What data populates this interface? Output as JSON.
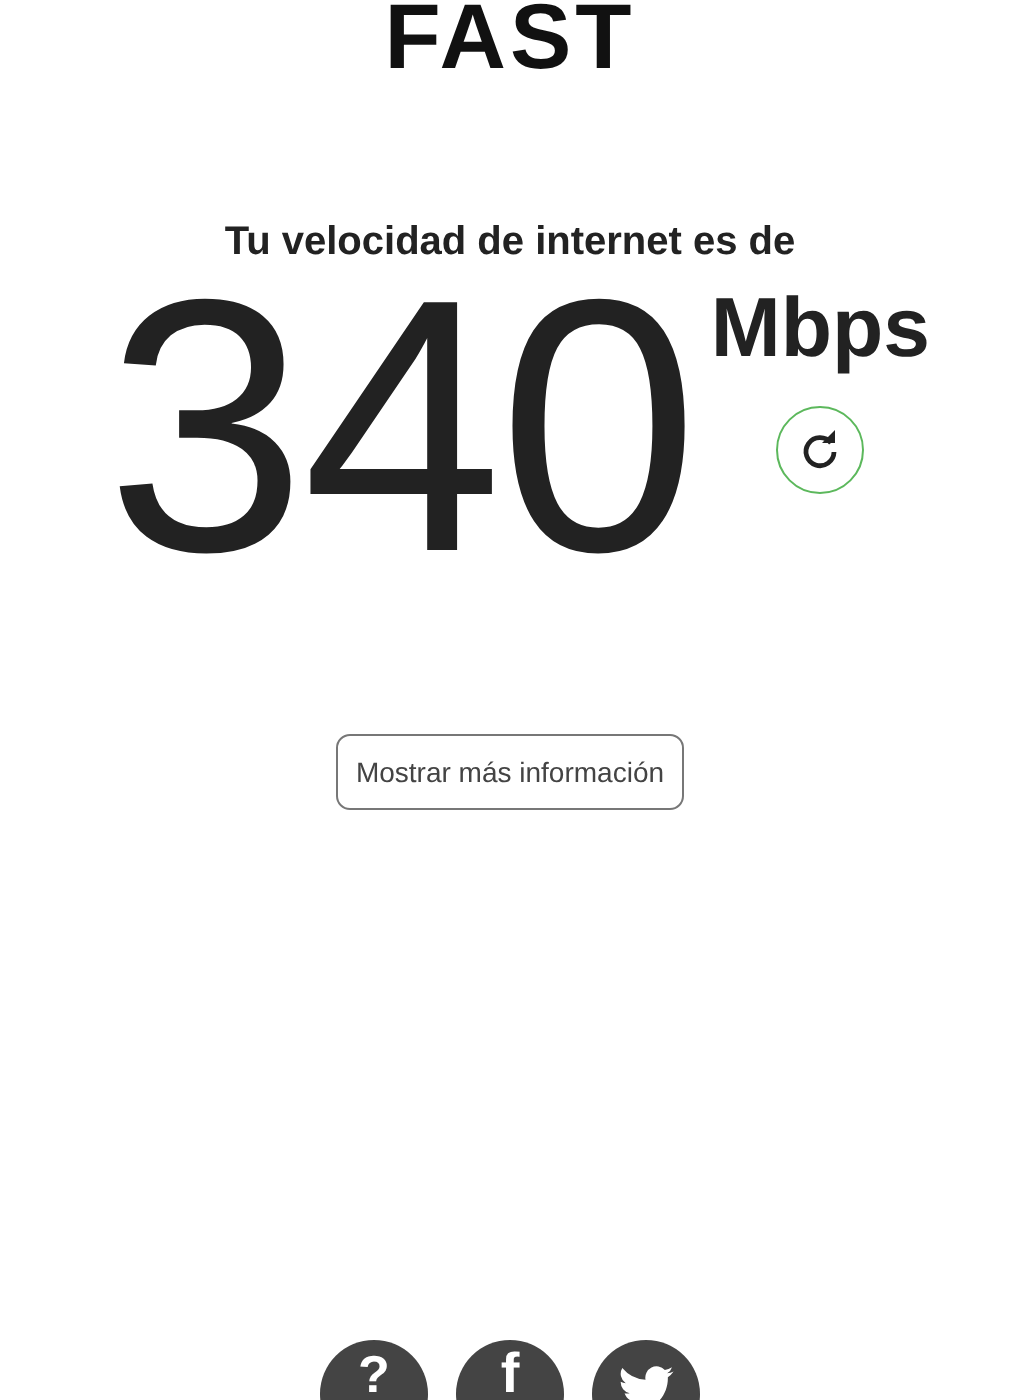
{
  "logo": "FAST",
  "heading": "Tu velocidad de internet es de",
  "speed": {
    "value": "340",
    "unit": "Mbps"
  },
  "more_button": "Mostrar más información",
  "footer_icons": [
    {
      "kind": "help",
      "glyph": "?"
    },
    {
      "kind": "facebook",
      "glyph": "f"
    },
    {
      "kind": "twitter"
    }
  ]
}
